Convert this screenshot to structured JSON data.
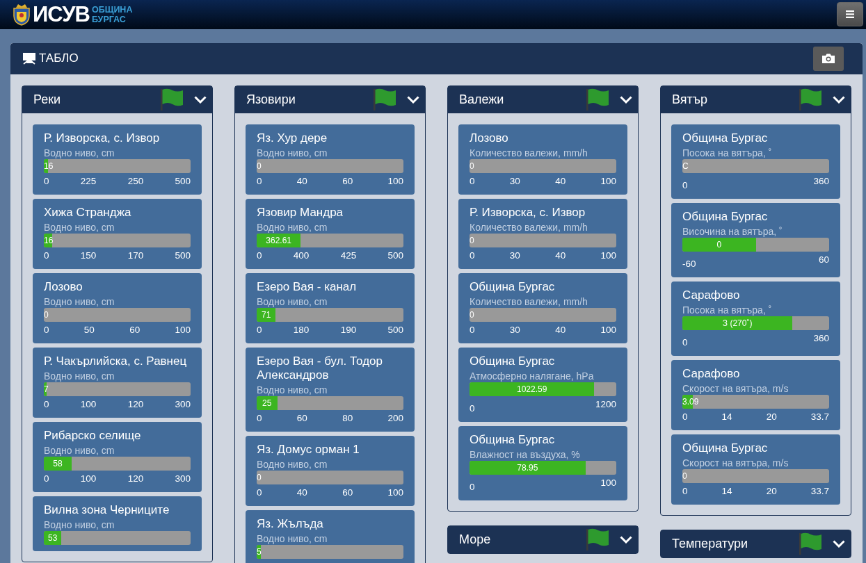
{
  "header": {
    "brand": "ИСУВ",
    "brand_sub": [
      "ОБЩИНА",
      "БУРГАС"
    ]
  },
  "dashboard": {
    "title": "ТАБЛО",
    "columns": [
      {
        "panels": [
          {
            "title": "Реки",
            "cards": [
              {
                "name": "Р. Изворска, с. Извор",
                "measure": "Водно ниво, cm",
                "value": "16",
                "level": 0.03,
                "kind": "thresholds",
                "ticks": [
                  "0",
                  "225",
                  "250",
                  "500"
                ]
              },
              {
                "name": "Хижа Странджа",
                "measure": "Водно ниво, cm",
                "value": "16",
                "level": 0.055,
                "kind": "thresholds",
                "ticks": [
                  "0",
                  "150",
                  "170",
                  "500"
                ]
              },
              {
                "name": "Лозово",
                "measure": "Водно ниво, cm",
                "value": "0",
                "level": 0,
                "kind": "thresholds",
                "ticks": [
                  "0",
                  "50",
                  "60",
                  "100"
                ]
              },
              {
                "name": "Р. Чакърлийска, с. Равнец",
                "measure": "Водно ниво, cm",
                "value": "7",
                "level": 0.02,
                "kind": "thresholds",
                "ticks": [
                  "0",
                  "100",
                  "120",
                  "300"
                ]
              },
              {
                "name": "Рибарско селище",
                "measure": "Водно ниво, cm",
                "value": "58",
                "level": 0.19,
                "kind": "thresholds",
                "ticks": [
                  "0",
                  "100",
                  "120",
                  "300"
                ]
              },
              {
                "name": "Вилна зона Черниците",
                "measure": "Водно ниво, cm",
                "value": "53",
                "level": 0.12
              }
            ]
          }
        ]
      },
      {
        "panels": [
          {
            "title": "Язовири",
            "cards": [
              {
                "name": "Яз. Хур дере",
                "measure": "Водно ниво, cm",
                "value": "0",
                "level": 0,
                "kind": "thresholds",
                "ticks": [
                  "0",
                  "40",
                  "60",
                  "100"
                ]
              },
              {
                "name": "Язовир Мандра",
                "measure": "Водно ниво, cm",
                "value": "362.61",
                "level": 0.3,
                "kind": "thresholds",
                "ticks": [
                  "0",
                  "400",
                  "425",
                  "500"
                ]
              },
              {
                "name": "Езеро Вая - канал",
                "measure": "Водно ниво, cm",
                "value": "71",
                "level": 0.13,
                "kind": "thresholds",
                "ticks": [
                  "0",
                  "180",
                  "190",
                  "500"
                ]
              },
              {
                "name": "Езеро Вая - бул. Тодор Александров",
                "measure": "Водно ниво, cm",
                "value": "25",
                "level": 0.14,
                "kind": "thresholds",
                "ticks": [
                  "0",
                  "60",
                  "80",
                  "200"
                ]
              },
              {
                "name": "Яз. Домус орман 1",
                "measure": "Водно ниво, cm",
                "value": "0",
                "level": 0,
                "kind": "thresholds",
                "ticks": [
                  "0",
                  "40",
                  "60",
                  "100"
                ]
              },
              {
                "name": "Яз. Жълъда",
                "measure": "Водно ниво, cm",
                "value": "5",
                "level": 0.03
              }
            ]
          }
        ]
      },
      {
        "panels": [
          {
            "title": "Валежи",
            "cards": [
              {
                "name": "Лозово",
                "measure": "Количество валежи, mm/h",
                "value": "0",
                "level": 0,
                "kind": "thresholds",
                "ticks": [
                  "0",
                  "30",
                  "40",
                  "100"
                ]
              },
              {
                "name": "Р. Изворска, с. Извор",
                "measure": "Количество валежи, mm/h",
                "value": "0",
                "level": 0,
                "kind": "thresholds",
                "ticks": [
                  "0",
                  "30",
                  "40",
                  "100"
                ]
              },
              {
                "name": "Община Бургас",
                "measure": "Количество валежи, mm/h",
                "value": "0",
                "level": 0,
                "kind": "thresholds",
                "ticks": [
                  "0",
                  "30",
                  "40",
                  "100"
                ]
              },
              {
                "name": "Община Бургас",
                "measure": "Атмосферно налягане, hPa",
                "value": "1022.59",
                "level": 0.85,
                "kind": "range",
                "ticks": [
                  "0",
                  "1200"
                ]
              },
              {
                "name": "Община Бургас",
                "measure": "Влажност на въздуха, %",
                "value": "78.95",
                "level": 0.79,
                "kind": "range",
                "ticks": [
                  "0",
                  "100"
                ]
              }
            ]
          },
          {
            "title": "Море"
          }
        ]
      },
      {
        "panels": [
          {
            "title": "Вятър",
            "cards": [
              {
                "name": "Община Бургас",
                "measure": "Посока на вятъра, ˚",
                "value": "С",
                "level": 0,
                "kind": "range",
                "ticks": [
                  "0",
                  "360"
                ]
              },
              {
                "name": "Община Бургас",
                "measure": "Височина на вятъра, ˚",
                "value": "0",
                "level": 0.5,
                "kind": "range",
                "ticks": [
                  "-60",
                  "60"
                ]
              },
              {
                "name": "Сарафово",
                "measure": "Посока на вятъра, ˚",
                "value": "З (270˚)",
                "level": 0.75,
                "kind": "range",
                "ticks": [
                  "0",
                  "360"
                ]
              },
              {
                "name": "Сарафово",
                "measure": "Скорост на вятъра, m/s",
                "value": "3.09",
                "level": 0.07,
                "kind": "thresholds",
                "ticks": [
                  "0",
                  "14",
                  "20",
                  "33.7"
                ]
              },
              {
                "name": "Община Бургас",
                "measure": "Скорост на вятъра, m/s",
                "value": "0",
                "level": 0,
                "kind": "thresholds",
                "ticks": [
                  "0",
                  "14",
                  "20",
                  "33.7"
                ]
              }
            ]
          },
          {
            "title": "Температури"
          }
        ]
      }
    ]
  }
}
